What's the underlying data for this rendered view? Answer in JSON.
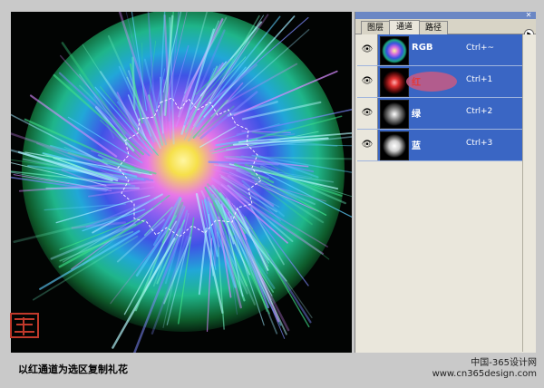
{
  "panel": {
    "tabs": [
      {
        "label": "图层"
      },
      {
        "label": "通道"
      },
      {
        "label": "路径"
      }
    ],
    "channels": [
      {
        "name": "RGB",
        "shortcut": "Ctrl+~"
      },
      {
        "name": "红",
        "shortcut": "Ctrl+1"
      },
      {
        "name": "绿",
        "shortcut": "Ctrl+2"
      },
      {
        "name": "蓝",
        "shortcut": "Ctrl+3"
      }
    ]
  },
  "caption": {
    "text": "以红通道为选区复制礼花"
  },
  "site": {
    "line1": "中国-365设计网",
    "line2": "www.cn365design.com"
  },
  "colors": {
    "accent": "#3a66c4",
    "panel_bg": "#eae7dc",
    "red_channel_label": "#e23a3a"
  }
}
